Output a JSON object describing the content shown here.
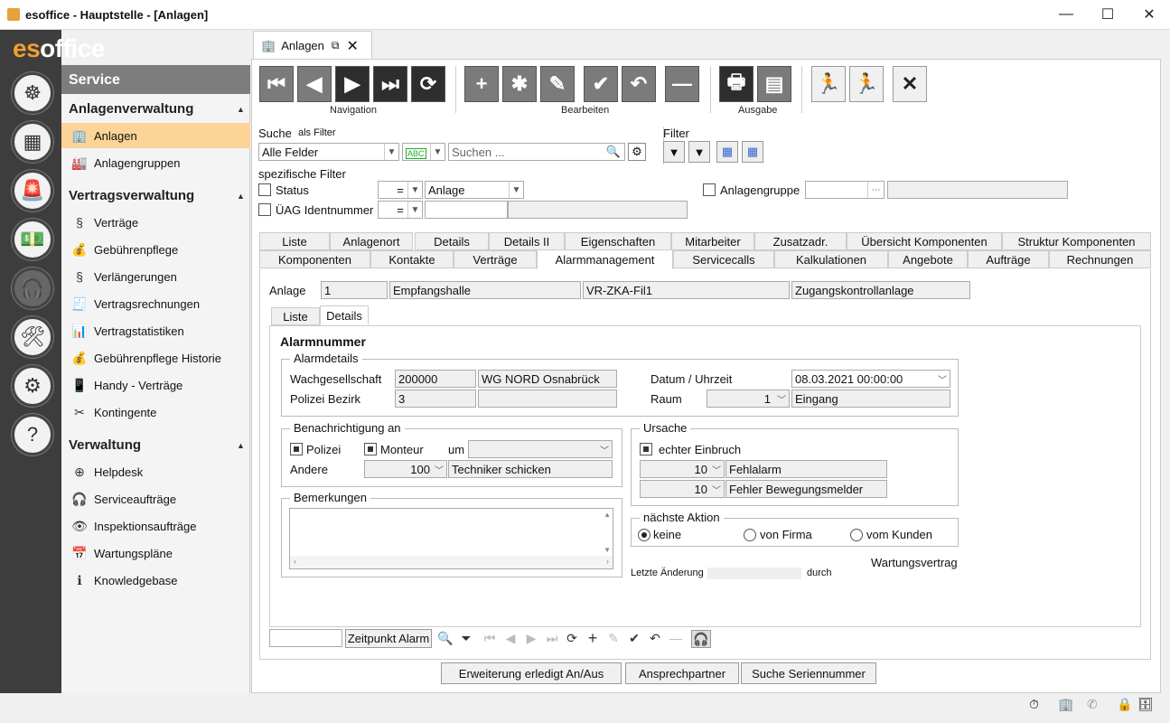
{
  "window": {
    "title": "esoffice - Hauptstelle - [Anlagen]",
    "min": "—",
    "max": "☐",
    "close": "✕"
  },
  "brand": {
    "part1": "es",
    "part2": "office"
  },
  "sidebar": {
    "section_title": "Service",
    "groups": [
      {
        "title": "Anlagenverwaltung",
        "items": [
          {
            "label": "Anlagen",
            "icon": "building-icon"
          },
          {
            "label": "Anlagengruppen",
            "icon": "buildings-icon"
          }
        ]
      },
      {
        "title": "Vertragsverwaltung",
        "items": [
          {
            "label": "Verträge",
            "icon": "paragraph-icon"
          },
          {
            "label": "Gebührenpflege",
            "icon": "moneybag-icon"
          },
          {
            "label": "Verlängerungen",
            "icon": "paragraph-renew-icon"
          },
          {
            "label": "Vertragsrechnungen",
            "icon": "invoice-icon"
          },
          {
            "label": "Vertragstatistiken",
            "icon": "statistics-icon"
          },
          {
            "label": "Gebührenpflege Historie",
            "icon": "history-icon"
          },
          {
            "label": "Handy - Verträge",
            "icon": "phone-icon"
          },
          {
            "label": "Kontingente",
            "icon": "tools-icon"
          }
        ]
      },
      {
        "title": "Verwaltung",
        "items": [
          {
            "label": "Helpdesk",
            "icon": "lifebuoy-icon"
          },
          {
            "label": "Serviceaufträge",
            "icon": "headset-icon"
          },
          {
            "label": "Inspektionsaufträge",
            "icon": "eye-icon"
          },
          {
            "label": "Wartungspläne",
            "icon": "calendar-icon"
          },
          {
            "label": "Knowledgebase",
            "icon": "info-icon"
          }
        ]
      }
    ]
  },
  "doc_tab": {
    "label": "Anlagen"
  },
  "toolbar": {
    "groups": [
      {
        "label": "Navigation"
      },
      {
        "label": "Bearbeiten"
      },
      {
        "label": "Ausgabe"
      }
    ],
    "buttons": {
      "first": "⏮",
      "prev": "◀",
      "next": "▶",
      "last": "⏭",
      "refresh": "⟳",
      "add": "+",
      "star": "✱",
      "edit": "✎",
      "save": "✔",
      "undo": "↶",
      "remove": "—",
      "print": "🖶",
      "export": "▤",
      "run1": "🏃",
      "run2": "🏃",
      "cancel": "✕"
    }
  },
  "search": {
    "label": "Suche",
    "as_filter": "als Filter",
    "field": "Alle Felder",
    "placeholder": "Suchen ...",
    "filter_label": "Filter"
  },
  "specific_filter": {
    "title": "spezifische Filter",
    "status_label": "Status",
    "status_op": "=",
    "status_value": "Anlage",
    "uag_label": "ÜAG Identnummer",
    "uag_op": "=",
    "group_label": "Anlagengruppe"
  },
  "tabs_row1": [
    "Liste",
    "Anlagenort",
    "Details",
    "Details II",
    "Eigenschaften",
    "Mitarbeiter",
    "Zusatzadr.",
    "Übersicht Komponenten",
    "Struktur Komponenten"
  ],
  "tabs_row2": [
    "Komponenten",
    "Kontakte",
    "Verträge",
    "Alarmmanagement",
    "Servicecalls",
    "Kalkulationen",
    "Angebote",
    "Aufträge",
    "Rechnungen"
  ],
  "anlage": {
    "label": "Anlage",
    "nr": "1",
    "name": "Empfangshalle",
    "code": "VR-ZKA-Fil1",
    "type": "Zugangskontrollanlage"
  },
  "subtabs": [
    "Liste",
    "Details"
  ],
  "alarm": {
    "title": "Alarmnummer",
    "details_legend": "Alarmdetails",
    "wach_label": "Wachgesellschaft",
    "wach_nr": "200000",
    "wach_name": "WG NORD Osnabrück",
    "polizei_label": "Polizei Bezirk",
    "polizei_nr": "3",
    "datum_label": "Datum / Uhrzeit",
    "datum": "08.03.2021 00:00:00",
    "raum_label": "Raum",
    "raum_nr": "1",
    "raum_name": "Eingang",
    "notify_legend": "Benachrichtigung an",
    "polizei_cb": "Polizei",
    "monteur_cb": "Monteur",
    "um_label": "um",
    "andere_label": "Andere",
    "andere_nr": "100",
    "andere_text": "Techniker schicken",
    "ursache_legend": "Ursache",
    "einbruch": "echter Einbruch",
    "u1_nr": "10",
    "u1_text": "Fehlalarm",
    "u2_nr": "10",
    "u2_text": "Fehler Bewegungsmelder",
    "bemerk_legend": "Bemerkungen",
    "aktion_legend": "nächste Aktion",
    "r1": "keine",
    "r2": "von Firma",
    "r3": "vom Kunden",
    "wartung": "Wartungsvertrag",
    "letzte": "Letzte Änderung",
    "durch": "durch"
  },
  "bottom_nav": {
    "zeitpunkt": "Zeitpunkt Alarm"
  },
  "buttons": {
    "b1": "Erweiterung erledigt An/Aus",
    "b2": "Ansprechpartner",
    "b3": "Suche Seriennummer"
  }
}
